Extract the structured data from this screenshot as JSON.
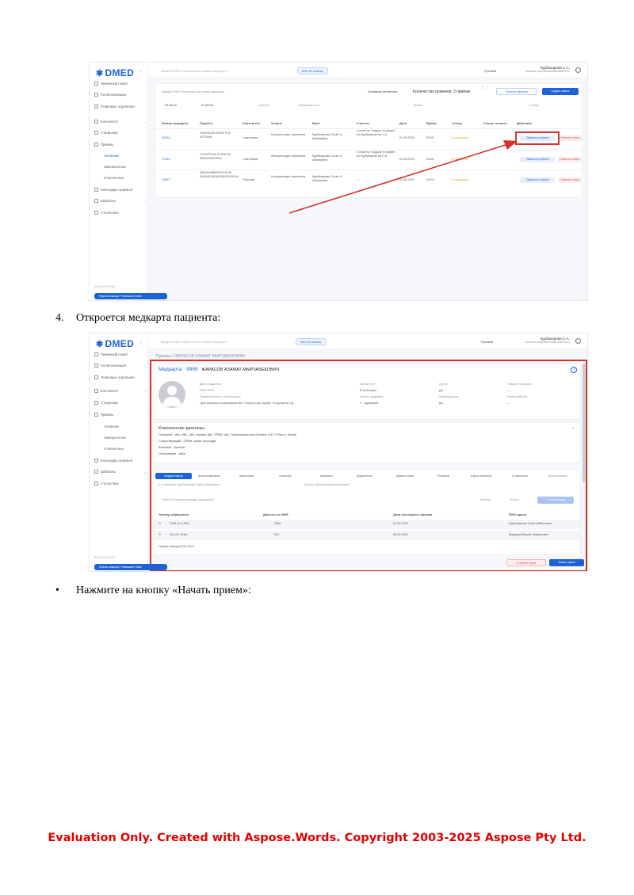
{
  "doc": {
    "step4_number": "4.",
    "step4_text": "Откроется медкарта пациента:",
    "bullet": "•",
    "bullet_text": "Нажмите на кнопку «Начать прием»:",
    "watermark": "Evaluation Only. Created with Aspose.Words. Copyright 2003-2025 Aspose Pty Ltd."
  },
  "app": {
    "logo": "DMED",
    "search_placeholder": "Введите ИИН пациента или номер медкарты",
    "medid_label": "Med ID сканер",
    "language": "Русский",
    "user_name": "Курбазарова С.А.",
    "user_email": "kurbazarova@bisnismedicalclinic.kz",
    "sidebar": {
      "items": [
        "Приемный покой",
        "Госпитализация",
        "Плановые отделения",
        "Контингент",
        "Стационар",
        "Приемы",
        "Календарь приемов",
        "Шаблоны",
        "Статистика"
      ],
      "subitems": [
        "Активные",
        "Завершенные",
        "Отмененные"
      ],
      "footer": "BIZARMOSUM",
      "help": "Нужна помощь? Напишите нам!"
    }
  },
  "shot1": {
    "search2": "Введите ИИН пациента или номер медкарты",
    "basic_contingent": "Основной контингент",
    "count_label": "Количество приемов: 3 приема",
    "badge": "1",
    "reset_filters": "Сбросить фильтры",
    "create_record": "Создать запись",
    "date_from": "01.05.24",
    "date_to": "01.05.24",
    "filter_section": "Участок",
    "filter_specialty": "Специальность",
    "filter_service": "Врачи",
    "filter_status": "Статус",
    "columns": [
      "Номер медкарты",
      "Пациент",
      "Контингент",
      "Услуги",
      "Врач",
      "Участок",
      "Дата",
      "Время",
      "Статус",
      "Статус оплаты",
      "Действия"
    ],
    "rows": [
      {
        "card": "16151",
        "patient": "ZAKIROVA RANO FUL ATOVNA",
        "contingent": "I категория",
        "service": "Консультация терапевта",
        "doctor": "Курбазарова Саule А Абаевовна",
        "area": "4 участок \"подраз та рамки\" во Курбазаров ва С.А.",
        "date": "01.05.2024",
        "time": "00:00",
        "status": "В ожидании"
      },
      {
        "card": "17461",
        "patient": "YUSUPOVA SYDHA M ATAKZANOVNA",
        "contingent": "I категория",
        "service": "Консультация терапевта",
        "doctor": "Курбазарова Саule А Абаевовна",
        "area": "4 участок \"подраз та рамки\" во Курбазаров ва С.А.",
        "date": "01.05.2024",
        "time": "00:00",
        "status": "В ожидании"
      },
      {
        "card": "12657",
        "patient": "ABDUKARIMOVA GUZI DILBAR ARANDZHONOVNA",
        "contingent": "Платный",
        "service": "Консультация терапевта",
        "doctor": "Курбазарова Саule А Абаевовна",
        "area": "—",
        "date": "01.05.2024",
        "time": "00:00",
        "status": "В ожидании"
      }
    ],
    "action_start": "Записать на прием",
    "action_cancel": "Отменить запись"
  },
  "shot2": {
    "breadcrumb": "Приемы / ЖАРАСОВ АЗАМАТ МЫРЗАБЕКОВИЧ",
    "card_label": "Медкарта · 9999",
    "patient_name": "ЖАРАСОВ АЗАМАТ МЫРЗАБЕКОВИЧ",
    "info_left": [
      "Дата рождения",
      "ИИН 9999",
      "Прикрепление к организации",
      "Центральная поликлиника №1 \"Ультра Гид Нормы\" Кз Дуларов Г.Д."
    ],
    "info_mid": [
      "Контингент",
      "В категория",
      "Группа здоровья",
      "1 - Здоровый"
    ],
    "info_right": [
      "Д-учет",
      "Да",
      "Инвалидность",
      "Да"
    ],
    "info_far": [
      "Номер телефона",
      "—",
      "Место работы",
      "—"
    ],
    "diag_title": "Клинические диагнозы",
    "diag_lines": [
      "Основной - абс, ИБС, абс, Ангина, абс, ОРВИ, абс, Гипертоническая болезнь II АГ 2 Риск 4, Вилия",
      "Сопутствующий - ОРВИ, ринит, простуда",
      "Фоновый - бронхит",
      "Осложнение - зубы"
    ],
    "tabs": [
      "Текущие осмотр",
      "Антропометрия",
      "Кинология",
      "Осмотры",
      "Анализы",
      "Документы",
      "Диагностика",
      "Рецепты",
      "Курсы лечений",
      "Стоматолог",
      "Визиограмма"
    ],
    "subline": "Кто записан: Курбазарова Саule Айбеновна",
    "subline2": "Услуга: Консультация терапевта",
    "search3": "Поиск по номеру эпизода обращения",
    "filter_from": "Начало",
    "filter_to": "Конец",
    "new_episode_btn": "+ Новый эпизод",
    "ep_columns": [
      "Эпизод обращения",
      "Диагноз по МКБ",
      "Дата последнего приема",
      "ФИО врача"
    ],
    "ep_rows": [
      {
        "ep": "2394 (2-Ч-ИР)",
        "diag": "2396",
        "date": "01.05.2024",
        "doc": "Курбазарова Саule Айбеновна"
      },
      {
        "ep": "241 (3- ИНА)",
        "diag": "241",
        "date": "06.04.2024",
        "doc": "Мурадов Жорэр Шамилович"
      }
    ],
    "new_ep_footer": "Новый эпизод 26.04.2024",
    "cancel_btn": "Отменить прием",
    "start_btn": "Начать прием"
  }
}
